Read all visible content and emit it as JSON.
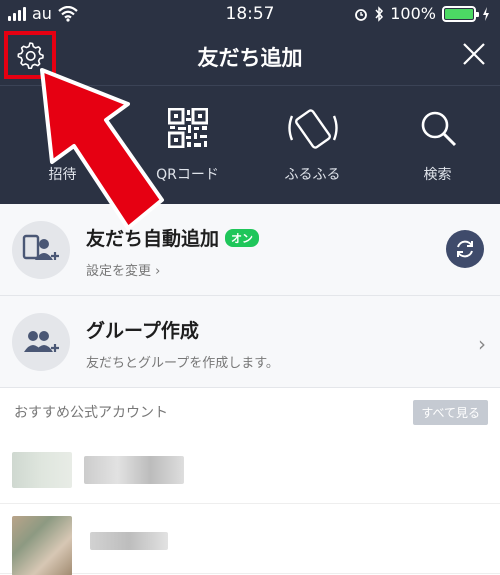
{
  "status_bar": {
    "carrier": "au",
    "time": "18:57",
    "battery": "100%"
  },
  "header": {
    "title": "友だち追加"
  },
  "methods": [
    {
      "label": "招待",
      "icon": "invite-icon"
    },
    {
      "label": "QRコード",
      "icon": "qr-code-icon"
    },
    {
      "label": "ふるふる",
      "icon": "shake-icon"
    },
    {
      "label": "検索",
      "icon": "search-icon"
    }
  ],
  "rows": {
    "auto_add": {
      "title": "友だち自動追加",
      "badge": "オン",
      "subtitle": "設定を変更 ›"
    },
    "group": {
      "title": "グループ作成",
      "subtitle": "友だちとグループを作成します。"
    }
  },
  "section": {
    "title": "おすすめ公式アカウント",
    "see_all": "すべて見る"
  },
  "colors": {
    "header_bg": "#2b3243",
    "highlight": "#e60012",
    "badge": "#1fc65a"
  }
}
